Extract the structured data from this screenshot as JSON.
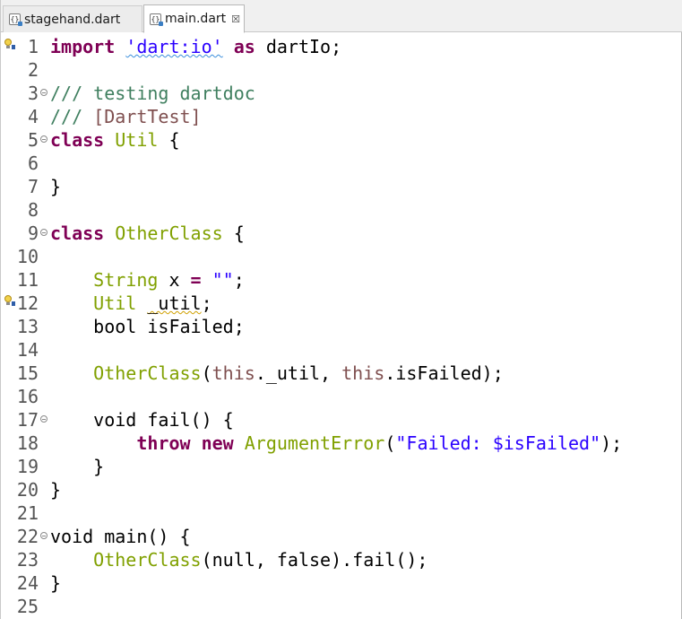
{
  "tabs": [
    {
      "label": "stagehand.dart",
      "active": false,
      "icon": "dart-file-icon"
    },
    {
      "label": "main.dart",
      "active": true,
      "icon": "dart-file-icon"
    }
  ],
  "file_icon_glyph": "{}",
  "close_glyph": "☒",
  "colors": {
    "keyword": "#7f0055",
    "string": "#2a00ff",
    "comment": "#3f7f5f",
    "doc_ref": "#7f4f4f",
    "type": "#80a000"
  },
  "lines": [
    {
      "n": "1",
      "marker": true,
      "tokens": [
        [
          "kw",
          "import"
        ],
        [
          "t",
          " "
        ],
        [
          "str-err",
          "'dart:io'"
        ],
        [
          "t",
          " "
        ],
        [
          "kw",
          "as"
        ],
        [
          "t",
          " dartIo;"
        ]
      ]
    },
    {
      "n": "2",
      "tokens": []
    },
    {
      "n": "3",
      "fold": true,
      "tokens": [
        [
          "cmt",
          "/// testing dartdoc"
        ]
      ]
    },
    {
      "n": "4",
      "tokens": [
        [
          "cmt",
          "/// "
        ],
        [
          "doc",
          "[DartTest]"
        ]
      ]
    },
    {
      "n": "5",
      "fold": true,
      "tokens": [
        [
          "kw",
          "class"
        ],
        [
          "t",
          " "
        ],
        [
          "ty",
          "Util"
        ],
        [
          "t",
          " {"
        ]
      ]
    },
    {
      "n": "6",
      "tokens": []
    },
    {
      "n": "7",
      "tokens": [
        [
          "t",
          "}"
        ]
      ]
    },
    {
      "n": "8",
      "tokens": []
    },
    {
      "n": "9",
      "fold": true,
      "tokens": [
        [
          "kw",
          "class"
        ],
        [
          "t",
          " "
        ],
        [
          "ty",
          "OtherClass"
        ],
        [
          "t",
          " {"
        ]
      ]
    },
    {
      "n": "10",
      "tokens": []
    },
    {
      "n": "11",
      "tokens": [
        [
          "t",
          "    "
        ],
        [
          "ty",
          "String"
        ],
        [
          "t",
          " x "
        ],
        [
          "kw",
          "="
        ],
        [
          "t",
          " "
        ],
        [
          "str",
          "\"\""
        ],
        [
          "t",
          ";"
        ]
      ]
    },
    {
      "n": "12",
      "marker": true,
      "tokens": [
        [
          "t",
          "    "
        ],
        [
          "ty",
          "Util"
        ],
        [
          "t",
          " "
        ],
        [
          "warn",
          "_util"
        ],
        [
          "t",
          ";"
        ]
      ]
    },
    {
      "n": "13",
      "tokens": [
        [
          "t",
          "    bool isFailed;"
        ]
      ]
    },
    {
      "n": "14",
      "tokens": []
    },
    {
      "n": "15",
      "tokens": [
        [
          "t",
          "    "
        ],
        [
          "ty",
          "OtherClass"
        ],
        [
          "t",
          "("
        ],
        [
          "th",
          "this"
        ],
        [
          "t",
          "._util, "
        ],
        [
          "th",
          "this"
        ],
        [
          "t",
          ".isFailed);"
        ]
      ]
    },
    {
      "n": "16",
      "tokens": []
    },
    {
      "n": "17",
      "fold": true,
      "tokens": [
        [
          "t",
          "    void fail() {"
        ]
      ]
    },
    {
      "n": "18",
      "tokens": [
        [
          "t",
          "        "
        ],
        [
          "kw",
          "throw"
        ],
        [
          "t",
          " "
        ],
        [
          "kw",
          "new"
        ],
        [
          "t",
          " "
        ],
        [
          "ty",
          "ArgumentError"
        ],
        [
          "t",
          "("
        ],
        [
          "str",
          "\"Failed: $isFailed\""
        ],
        [
          "t",
          ");"
        ]
      ]
    },
    {
      "n": "19",
      "tokens": [
        [
          "t",
          "    }"
        ]
      ]
    },
    {
      "n": "20",
      "tokens": [
        [
          "t",
          "}"
        ]
      ]
    },
    {
      "n": "21",
      "tokens": []
    },
    {
      "n": "22",
      "fold": true,
      "tokens": [
        [
          "t",
          "void main() {"
        ]
      ]
    },
    {
      "n": "23",
      "tokens": [
        [
          "t",
          "    "
        ],
        [
          "ty",
          "OtherClass"
        ],
        [
          "t",
          "(null, false).fail();"
        ]
      ]
    },
    {
      "n": "24",
      "tokens": [
        [
          "t",
          "}"
        ]
      ]
    },
    {
      "n": "25",
      "tokens": []
    }
  ]
}
